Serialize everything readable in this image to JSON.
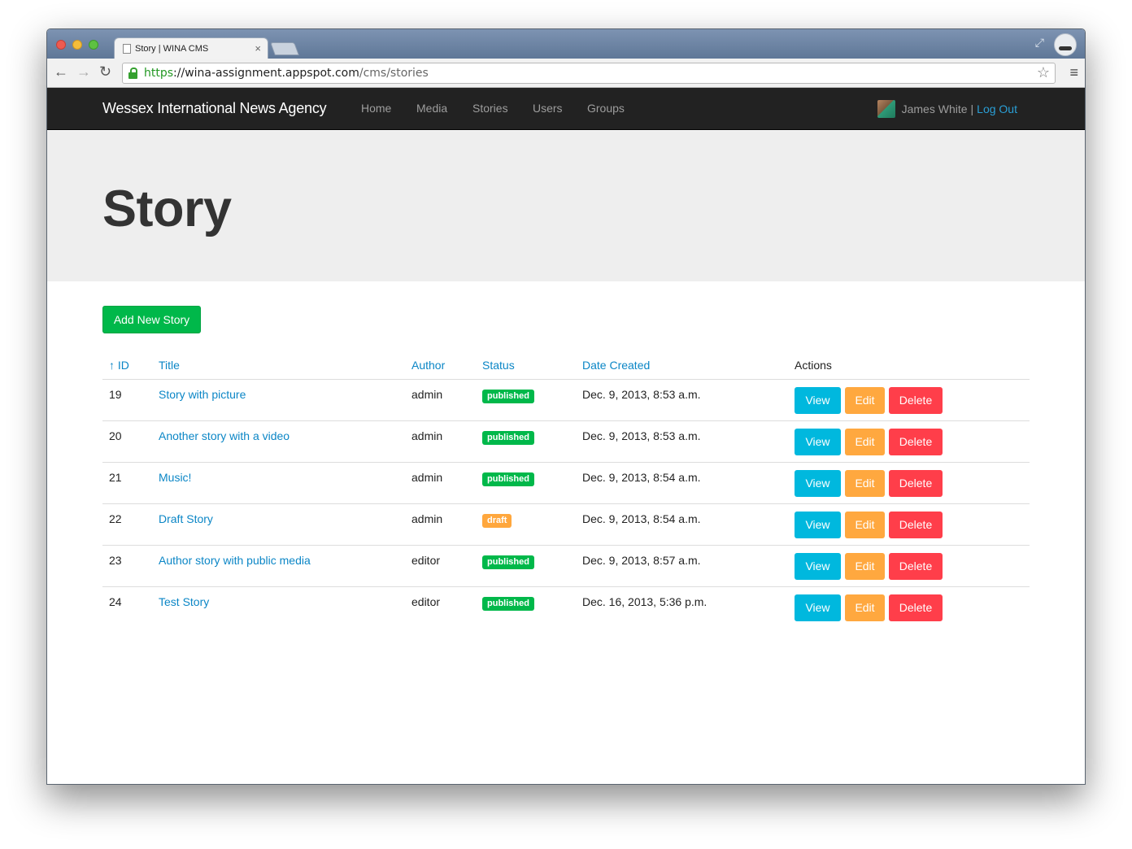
{
  "browser": {
    "tab_title": "Story | WINA CMS",
    "tab_close": "×",
    "url_scheme": "https",
    "url_host": "://wina-assignment.appspot.com",
    "url_path": "/cms/stories",
    "back": "←",
    "forward": "→",
    "reload": "↻",
    "star": "☆",
    "menu": "≡",
    "fullscreen": "⤢"
  },
  "navbar": {
    "brand": "Wessex International News Agency",
    "links": [
      "Home",
      "Media",
      "Stories",
      "Users",
      "Groups"
    ],
    "user_name": "James White",
    "separator": "|",
    "logout": "Log Out"
  },
  "page": {
    "title": "Story",
    "add_button": "Add New Story"
  },
  "table": {
    "headers": {
      "id": "↑ ID",
      "title": "Title",
      "author": "Author",
      "status": "Status",
      "date_created": "Date Created",
      "actions": "Actions"
    },
    "action_labels": {
      "view": "View",
      "edit": "Edit",
      "delete": "Delete"
    },
    "rows": [
      {
        "id": "19",
        "title": "Story with picture",
        "author": "admin",
        "status": "published",
        "date": "Dec. 9, 2013, 8:53 a.m."
      },
      {
        "id": "20",
        "title": "Another story with a video",
        "author": "admin",
        "status": "published",
        "date": "Dec. 9, 2013, 8:53 a.m."
      },
      {
        "id": "21",
        "title": "Music!",
        "author": "admin",
        "status": "published",
        "date": "Dec. 9, 2013, 8:54 a.m."
      },
      {
        "id": "22",
        "title": "Draft Story",
        "author": "admin",
        "status": "draft",
        "date": "Dec. 9, 2013, 8:54 a.m."
      },
      {
        "id": "23",
        "title": "Author story with public media",
        "author": "editor",
        "status": "published",
        "date": "Dec. 9, 2013, 8:57 a.m."
      },
      {
        "id": "24",
        "title": "Test Story",
        "author": "editor",
        "status": "published",
        "date": "Dec. 16, 2013, 5:36 p.m."
      }
    ]
  },
  "colors": {
    "navbar_bg": "#222222",
    "link": "#0b86c6",
    "published": "#00b84a",
    "draft": "#ffa73d",
    "view": "#00b8de",
    "edit": "#ffa83f",
    "delete": "#ff3e4a"
  }
}
